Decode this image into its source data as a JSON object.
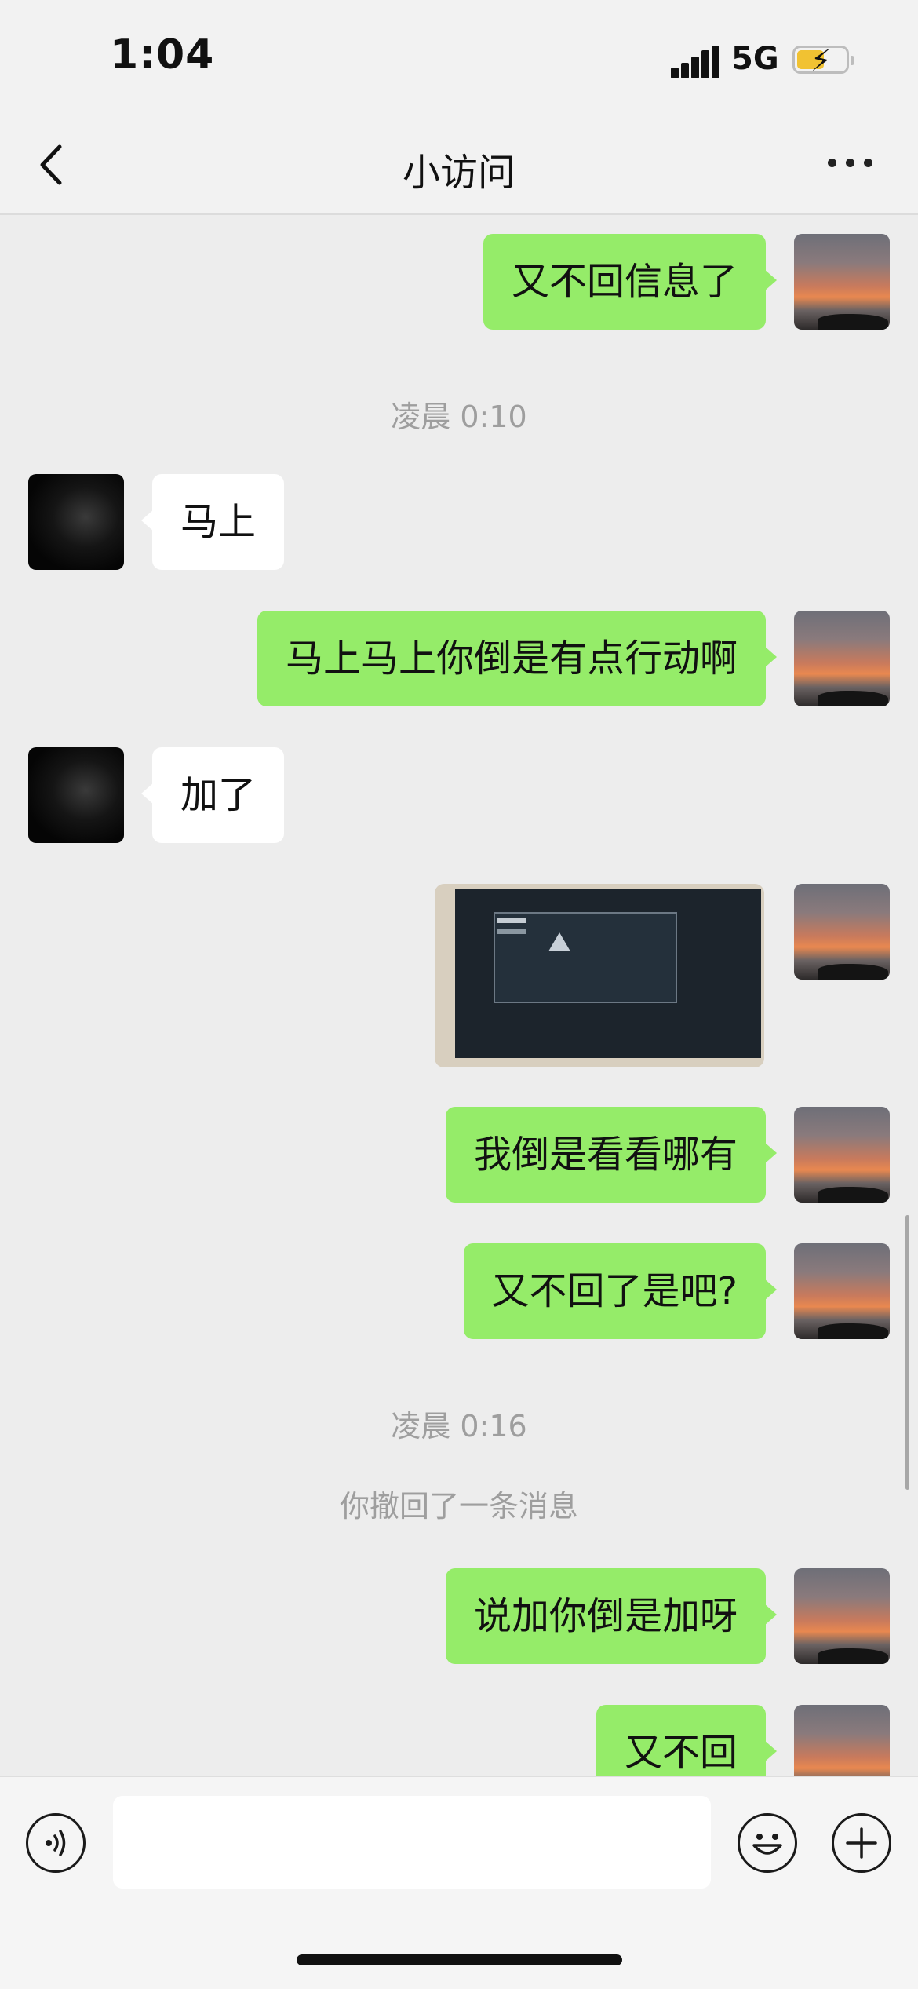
{
  "status_bar": {
    "time": "1:04",
    "network": "5G",
    "battery_icon": "battery-charging-icon"
  },
  "nav": {
    "title": "小访问",
    "back_icon": "back-chevron-icon",
    "more_icon": "more-dots-icon"
  },
  "messages": [
    {
      "type": "sent",
      "text": "又不回信息了"
    },
    {
      "type": "time",
      "text": "凌晨 0:10"
    },
    {
      "type": "received",
      "text": "马上"
    },
    {
      "type": "sent",
      "text": "马上马上你倒是有点行动啊"
    },
    {
      "type": "received",
      "text": "加了"
    },
    {
      "type": "sent-image"
    },
    {
      "type": "sent",
      "text": "我倒是看看哪有"
    },
    {
      "type": "sent",
      "text": "又不回了是吧?"
    },
    {
      "type": "time",
      "text": "凌晨 0:16"
    },
    {
      "type": "system",
      "text": "你撤回了一条消息"
    },
    {
      "type": "sent",
      "text": "说加你倒是加呀"
    },
    {
      "type": "sent",
      "text": "又不回"
    }
  ],
  "input_bar": {
    "voice_icon": "voice-icon",
    "text_value": "",
    "emoji_icon": "emoji-icon",
    "plus_icon": "plus-icon"
  },
  "colors": {
    "sent_bubble": "#95ec69",
    "received_bubble": "#ffffff",
    "background": "#ededed"
  }
}
